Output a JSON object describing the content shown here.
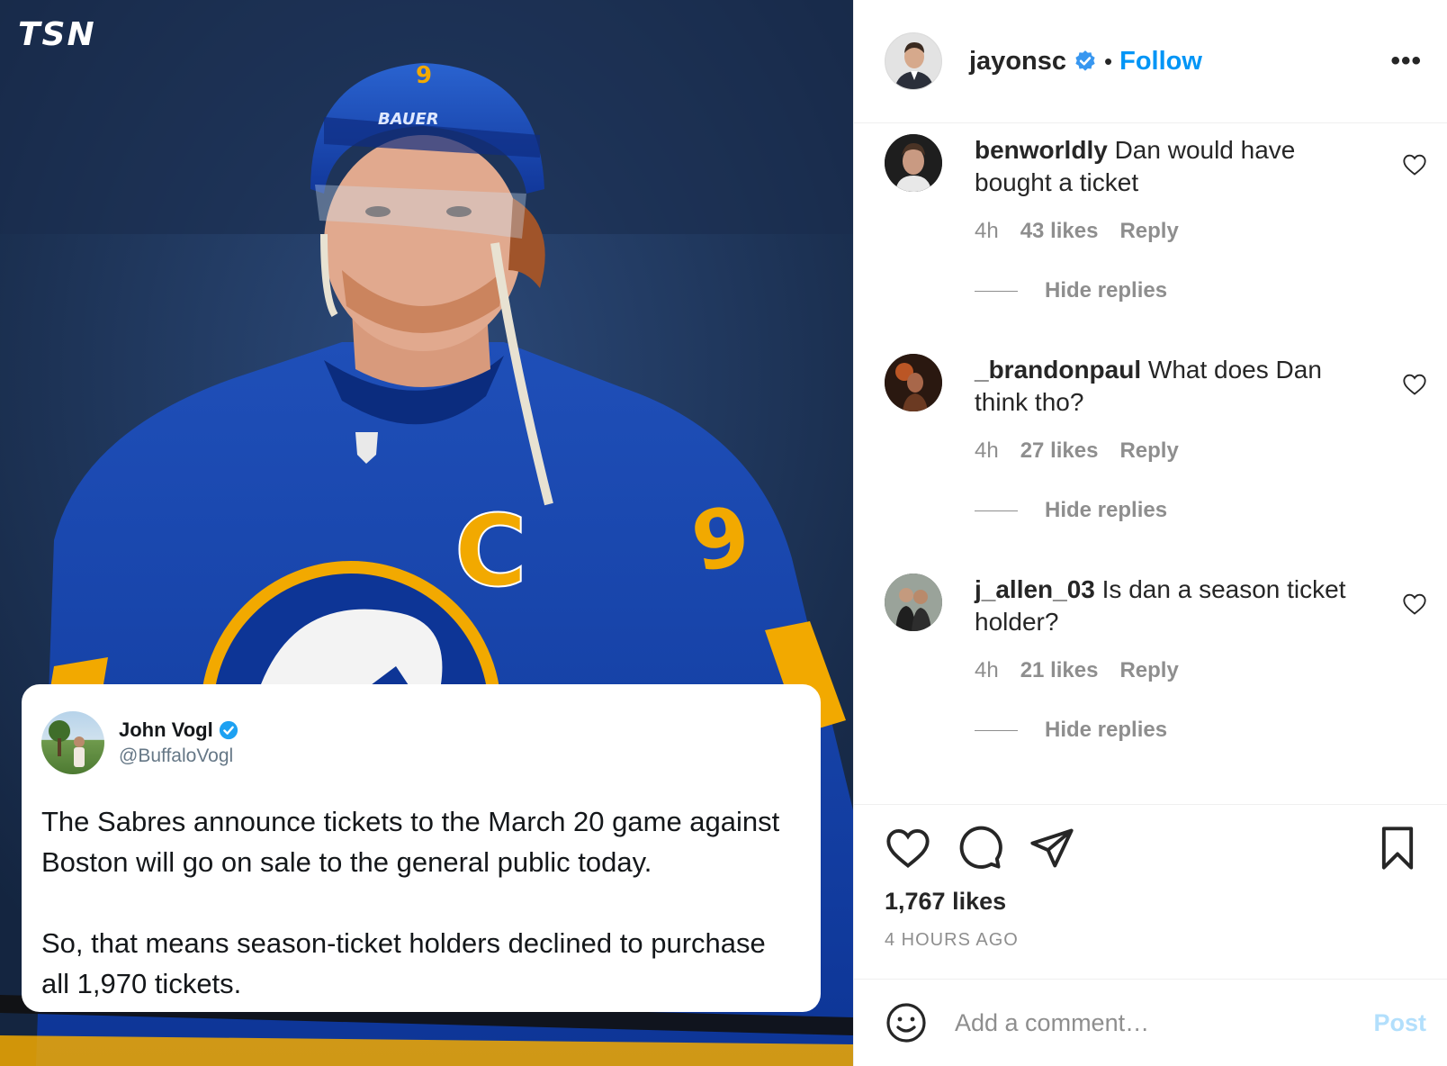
{
  "photo": {
    "logo": "TSN",
    "tweet": {
      "name": "John Vogl",
      "handle": "@BuffaloVogl",
      "text": "The Sabres announce tickets to the March 20 game against Boston will go on sale to the general public today.\n\nSo, that means season-ticket holders declined to purchase all 1,970 tickets."
    }
  },
  "header": {
    "username": "jayonsc",
    "separator": "•",
    "follow_label": "Follow",
    "more_label": "•••"
  },
  "comments": [
    {
      "user": "benworldly",
      "text": "Dan would have bought a ticket",
      "time": "4h",
      "likes": "43 likes",
      "reply_label": "Reply",
      "hide_replies": "Hide replies"
    },
    {
      "user": "_brandonpaul",
      "text": "What does Dan think tho?",
      "time": "4h",
      "likes": "27 likes",
      "reply_label": "Reply",
      "hide_replies": "Hide replies"
    },
    {
      "user": "j_allen_03",
      "text": "Is dan a season ticket holder?",
      "time": "4h",
      "likes": "21 likes",
      "reply_label": "Reply",
      "hide_replies": "Hide replies"
    }
  ],
  "footer": {
    "likes": "1,767 likes",
    "time_ago": "4 HOURS AGO",
    "comment_placeholder": "Add a comment…",
    "post_label": "Post"
  },
  "colors": {
    "accent": "#0095f6",
    "post_disabled": "#b2dffc",
    "sabres_blue": "#0d3fa3",
    "sabres_gold": "#f2a900"
  },
  "icons": {
    "verified": "verified-badge-icon",
    "like": "heart-icon",
    "comment": "comment-bubble-icon",
    "share": "paper-plane-icon",
    "save": "bookmark-icon",
    "emoji": "smiley-icon",
    "more": "more-dots-icon"
  }
}
